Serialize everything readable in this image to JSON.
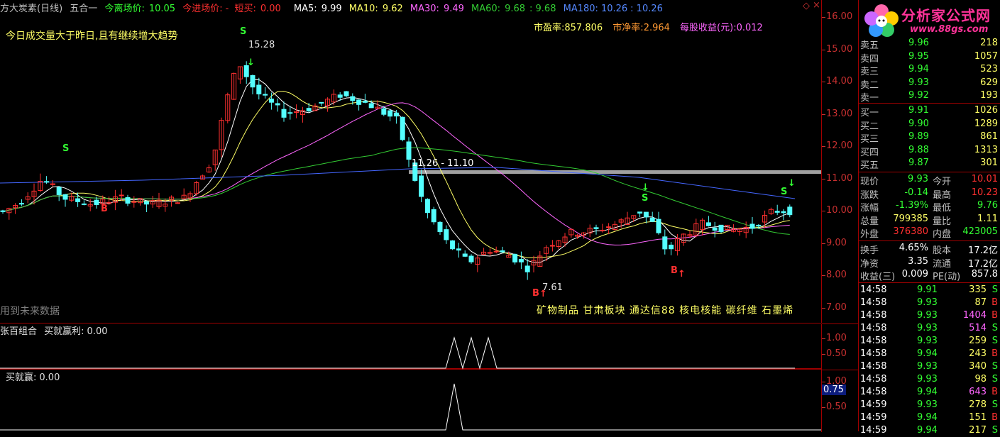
{
  "colors": {
    "up": "#ff3030",
    "down": "#54ffff",
    "ma5": "#ffffff",
    "ma10": "#ffff66",
    "ma30": "#ff66ff",
    "ma60": "#33cc33",
    "ma180": "#4466ff",
    "grid_red": "#a00000",
    "label_yellow": "#ffff00",
    "label_orange": "#ff9933"
  },
  "topbar": {
    "title": "方大炭素(日线)",
    "indicator": "五合一",
    "exit_label": "今离场价:",
    "exit_value": "10.05",
    "entry_label": "今进场价:",
    "entry_dash": "-",
    "short_buy_label": "短买:",
    "short_buy_value": "0.00",
    "ma5_label": "MA5:",
    "ma5_value": "9.99",
    "ma10_label": "MA10:",
    "ma10_value": "9.62",
    "ma30_label": "MA30:",
    "ma30_value": "9.49",
    "ma60_label": "MA60:",
    "ma60_value": "9.68",
    "ma60_value2": ": 9.68",
    "ma180_label": "MA180:",
    "ma180_value": "10.26",
    "ma180_value2": ": 10.26"
  },
  "main": {
    "note": "今日成交量大于昨日,且有继续增大趋势",
    "pe_label": "市盈率:",
    "pe_value": "857.806",
    "pb_label": "市净率:",
    "pb_value": "2.964",
    "eps_label": "每股收益(元):",
    "eps_value": "0.012",
    "future_data": "用到未来数据",
    "high_label": "15.28",
    "low_label": "7.61",
    "range_label": "11.26 - 11.10",
    "concepts": "矿物制品 甘肃板块 通达信88 核电核能 碳纤维 石墨烯",
    "signals": {
      "s": "S",
      "b": "B"
    }
  },
  "price_axis": [
    "16.00",
    "15.00",
    "14.00",
    "13.00",
    "12.00",
    "11.00",
    "10.00",
    "9.00",
    "8.00",
    "7.00"
  ],
  "panel2": {
    "title": "张百组合",
    "label": "买就赢利:",
    "value": "0.00",
    "ticks": [
      "1.00",
      "0.50"
    ]
  },
  "panel3": {
    "label": "买就赢:",
    "value": "0.00",
    "ticks": [
      "1.00",
      "0.50"
    ],
    "highlight": "0.75"
  },
  "logo": {
    "name": "分析家公式网",
    "url": "www.88gs.com"
  },
  "order_book": {
    "sell": [
      {
        "label": "卖五",
        "price": "9.96",
        "vol": "218"
      },
      {
        "label": "卖四",
        "price": "9.95",
        "vol": "1057"
      },
      {
        "label": "卖三",
        "price": "9.94",
        "vol": "523"
      },
      {
        "label": "卖二",
        "price": "9.93",
        "vol": "629"
      },
      {
        "label": "卖一",
        "price": "9.92",
        "vol": "193"
      }
    ],
    "buy": [
      {
        "label": "买一",
        "price": "9.91",
        "vol": "1026"
      },
      {
        "label": "买二",
        "price": "9.90",
        "vol": "1289"
      },
      {
        "label": "买三",
        "price": "9.89",
        "vol": "861"
      },
      {
        "label": "买四",
        "price": "9.88",
        "vol": "1313"
      },
      {
        "label": "买五",
        "price": "9.87",
        "vol": "301"
      }
    ]
  },
  "quote": [
    {
      "l1": "现价",
      "v1": "9.93",
      "l2": "今开",
      "v2": "10.01"
    },
    {
      "l1": "涨跌",
      "v1": "-0.14",
      "l2": "最高",
      "v2": "10.23"
    },
    {
      "l1": "涨幅",
      "v1": "-1.39%",
      "l2": "最低",
      "v2": "9.76"
    },
    {
      "l1": "总量",
      "v1": "799385",
      "l2": "量比",
      "v2": "1.11"
    },
    {
      "l1": "外盘",
      "v1": "376380",
      "l2": "内盘",
      "v2": "423005"
    }
  ],
  "fundamentals": [
    {
      "l1": "换手",
      "v1": "4.65%",
      "l2": "股本",
      "v2": "17.2亿"
    },
    {
      "l1": "净资",
      "v1": "3.35",
      "l2": "流通",
      "v2": "17.2亿"
    },
    {
      "l1": "收益(三)",
      "v1": "0.009",
      "l2": "PE(动)",
      "v2": "857.8"
    }
  ],
  "ticks": [
    {
      "time": "14:58",
      "price": "9.91",
      "vol": "335",
      "side": "S"
    },
    {
      "time": "14:58",
      "price": "9.93",
      "vol": "87",
      "side": "B"
    },
    {
      "time": "14:58",
      "price": "9.93",
      "vol": "1404",
      "side": "B"
    },
    {
      "time": "14:58",
      "price": "9.93",
      "vol": "514",
      "side": "S"
    },
    {
      "time": "14:58",
      "price": "9.93",
      "vol": "259",
      "side": "S"
    },
    {
      "time": "14:58",
      "price": "9.94",
      "vol": "243",
      "side": "B"
    },
    {
      "time": "14:58",
      "price": "9.93",
      "vol": "340",
      "side": "S"
    },
    {
      "time": "14:58",
      "price": "9.93",
      "vol": "98",
      "side": "S"
    },
    {
      "time": "14:58",
      "price": "9.94",
      "vol": "643",
      "side": "B"
    },
    {
      "time": "14:59",
      "price": "9.93",
      "vol": "278",
      "side": "S"
    },
    {
      "time": "14:59",
      "price": "9.94",
      "vol": "151",
      "side": "B"
    },
    {
      "time": "14:59",
      "price": "9.94",
      "vol": "217",
      "side": "S"
    }
  ]
}
